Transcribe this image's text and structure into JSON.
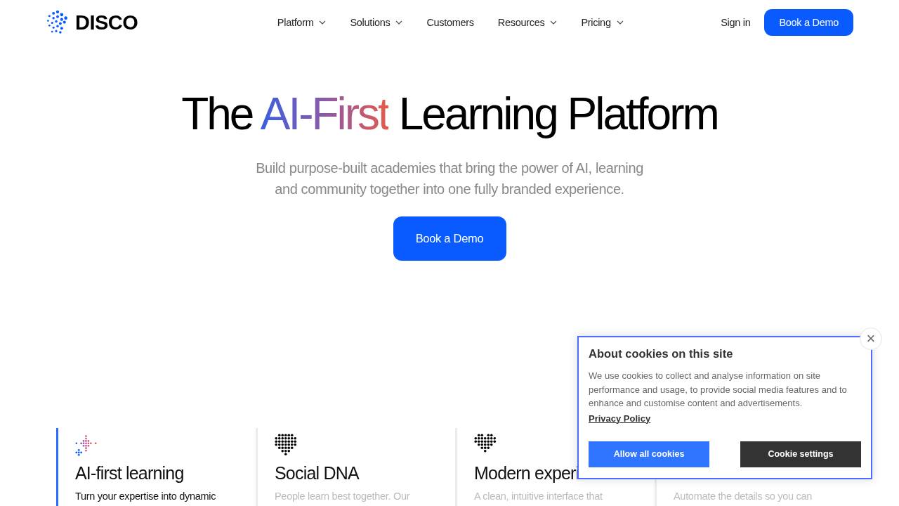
{
  "header": {
    "logo": "DISCO",
    "nav": [
      {
        "label": "Platform",
        "has_menu": true
      },
      {
        "label": "Solutions",
        "has_menu": true
      },
      {
        "label": "Customers",
        "has_menu": false
      },
      {
        "label": "Resources",
        "has_menu": true
      },
      {
        "label": "Pricing",
        "has_menu": true
      }
    ],
    "sign_in": "Sign in",
    "cta": "Book a Demo"
  },
  "hero": {
    "title_before": "The ",
    "title_highlight": "AI-First",
    "title_after": " Learning Platform",
    "subtitle": "Build purpose-built academies that bring the power of AI, learning and community together into one fully branded experience.",
    "cta": "Book a Demo"
  },
  "features": [
    {
      "kind": "sparkle",
      "title": "AI-first learning",
      "text": "Turn your expertise into dynamic",
      "selected": true
    },
    {
      "kind": "bubble",
      "title": "Social DNA",
      "text": "People learn best together. Our",
      "selected": false
    },
    {
      "kind": "heart",
      "title": "Modern experi",
      "text": "A clean, intuitive interface that",
      "selected": false
    },
    {
      "kind": "none",
      "text": "Automate the details so you can",
      "selected": false
    }
  ],
  "cookie_banner": {
    "title": "About cookies on this site",
    "text": "We use cookies to collect and analyse information on site performance and usage, to provide social media features and to enhance and customise content and advertisements.",
    "link": "Privacy Policy",
    "accept": "Allow all cookies",
    "settings": "Cookie settings",
    "close": "×"
  }
}
